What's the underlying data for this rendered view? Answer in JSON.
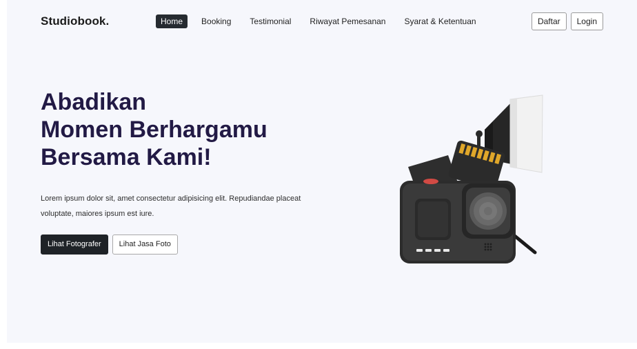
{
  "navbar": {
    "brand": "Studiobook.",
    "links": [
      {
        "label": "Home",
        "active": true
      },
      {
        "label": "Booking",
        "active": false
      },
      {
        "label": "Testimonial",
        "active": false
      },
      {
        "label": "Riwayat Pemesanan",
        "active": false
      },
      {
        "label": "Syarat & Ketentuan",
        "active": false
      }
    ],
    "register_label": "Daftar",
    "login_label": "Login"
  },
  "hero": {
    "title_lines": [
      "Abadikan",
      "Momen Berhargamu",
      "Bersama Kami!"
    ],
    "description": "Lorem ipsum dolor sit, amet consectetur adipisicing elit. Repudiandae placeat voluptate, maiores ipsum est iure.",
    "primary_button": "Lihat Fotografer",
    "secondary_button": "Lihat Jasa Foto",
    "illustration_icon": "action-camera-illustration"
  },
  "colors": {
    "background": "#f6f7fc",
    "title": "#221a45",
    "active_nav": "#262b30",
    "primary_button": "#1f2327"
  }
}
